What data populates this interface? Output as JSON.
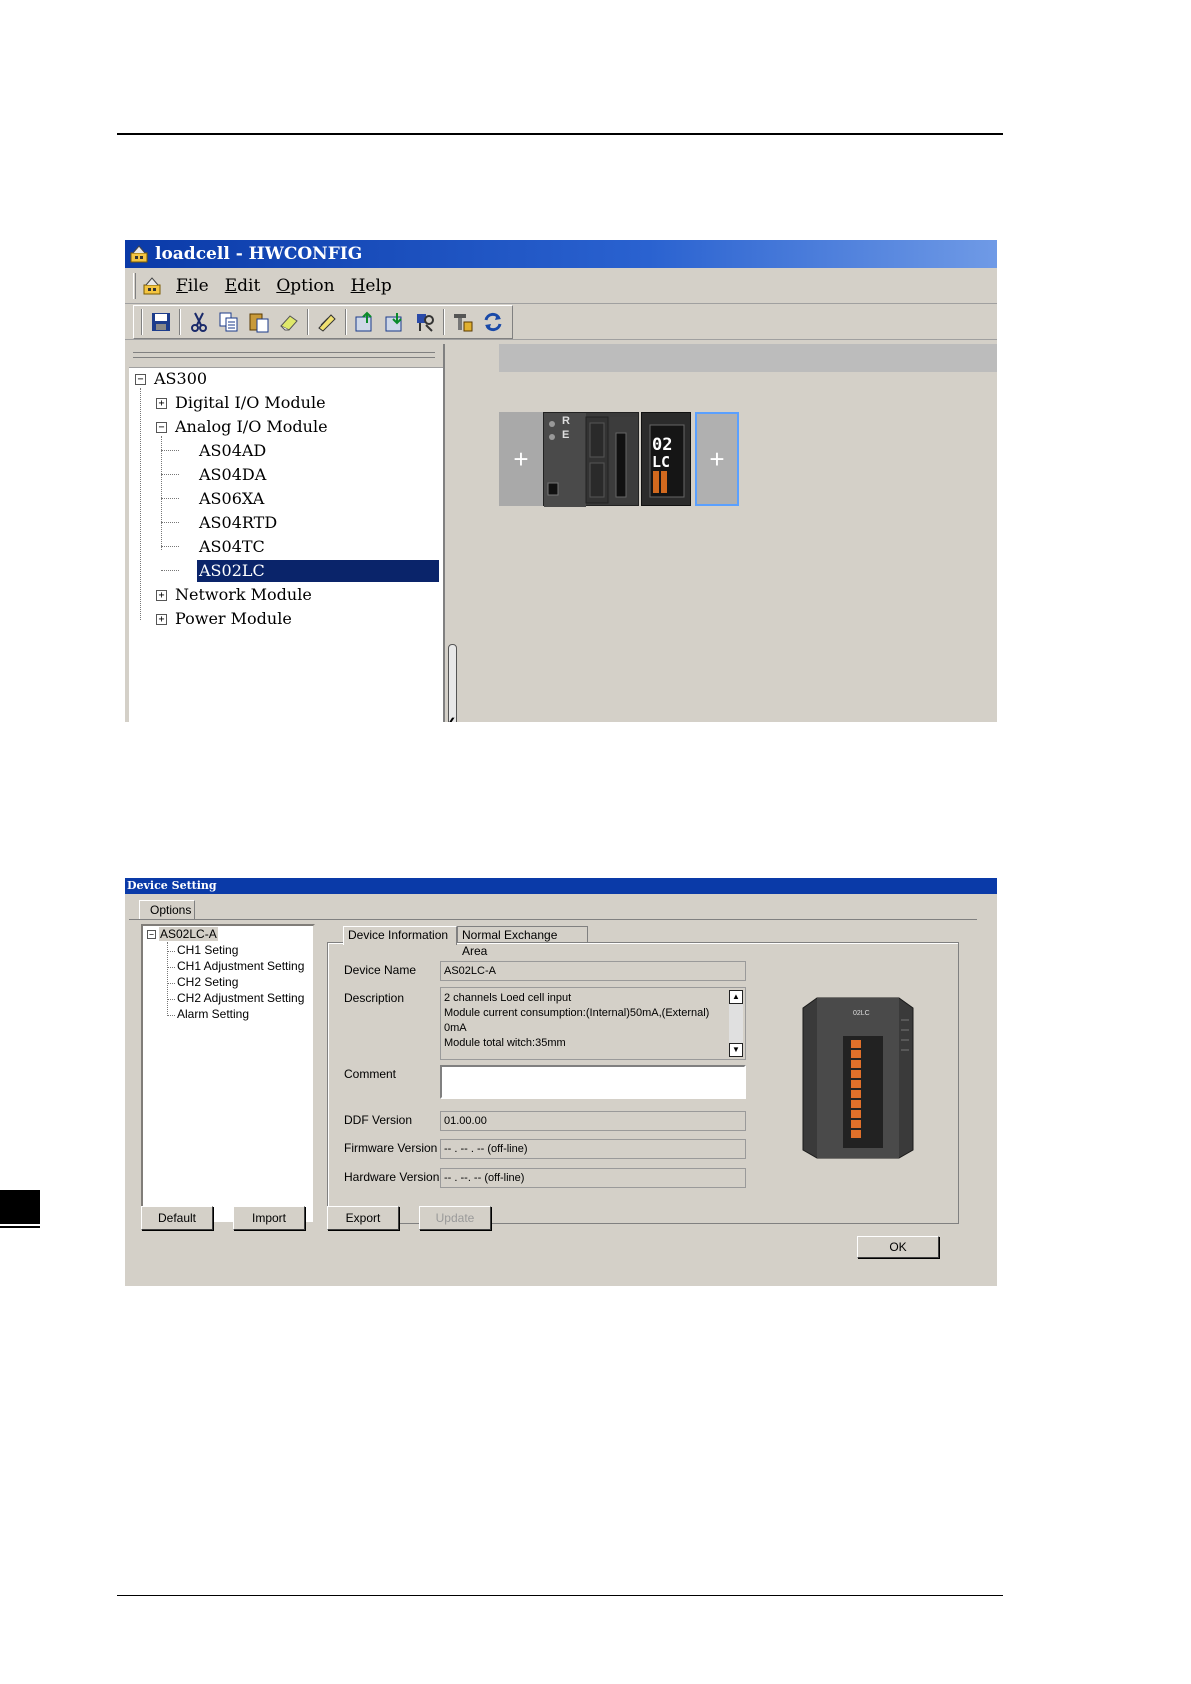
{
  "hwconfig": {
    "title": "loadcell - HWCONFIG",
    "menu": [
      {
        "label": "File",
        "accel": "F",
        "rest": "ile"
      },
      {
        "label": "Edit",
        "accel": "E",
        "rest": "dit"
      },
      {
        "label": "Option",
        "accel": "O",
        "rest": "ption"
      },
      {
        "label": "Help",
        "accel": "H",
        "rest": "elp"
      }
    ],
    "toolbar_icons": [
      "save-icon",
      "cut-icon",
      "copy-icon",
      "paste-icon",
      "eraser-icon",
      "pen-icon",
      "upload-icon",
      "download-icon",
      "scan-icon",
      "parameter-icon",
      "sync-icon"
    ],
    "tree": {
      "root": "AS300",
      "items": [
        {
          "label": "Digital I/O Module",
          "expander": "+"
        },
        {
          "label": "Analog I/O Module",
          "expander": "−"
        },
        {
          "label": "AS04AD"
        },
        {
          "label": "AS04DA"
        },
        {
          "label": "AS06XA"
        },
        {
          "label": "AS04RTD"
        },
        {
          "label": "AS04TC"
        },
        {
          "label": "AS02LC",
          "selected": true
        },
        {
          "label": "Network Module",
          "expander": "+"
        },
        {
          "label": "Power Module",
          "expander": "+"
        }
      ],
      "root_expander": "−"
    },
    "rack": {
      "plus": "+",
      "cpu_letters": [
        "R",
        "E"
      ],
      "lc_label_top": "02",
      "lc_label_bottom": "LC"
    }
  },
  "device_setting": {
    "title": "Device Setting",
    "options_tab": "Options",
    "tree": {
      "root_expander": "−",
      "root": "AS02LC-A",
      "children": [
        "CH1 Seting",
        "CH1 Adjustment Setting",
        "CH2 Seting",
        "CH2 Adjustment Setting",
        "Alarm Setting"
      ]
    },
    "tabs": [
      "Device Information",
      "Normal Exchange Area"
    ],
    "fields": {
      "device_name_label": "Device Name",
      "device_name": "AS02LC-A",
      "description_label": "Description",
      "description_lines": [
        "2 channels Loed cell input",
        "Module current consumption:(Internal)50mA,(External)",
        "0mA",
        "Module total witch:35mm"
      ],
      "comment_label": "Comment",
      "comment": "",
      "ddf_version_label": "DDF Version",
      "ddf_version": "01.00.00",
      "firmware_version_label": "Firmware Version",
      "firmware_version": "-- . -- . -- (off-line)",
      "hardware_version_label": "Hardware Version",
      "hardware_version": "-- . --. -- (off-line)"
    },
    "buttons": {
      "default": "Default",
      "import": "Import",
      "export": "Export",
      "update": "Update",
      "ok": "OK"
    },
    "device_label": "02LC"
  }
}
